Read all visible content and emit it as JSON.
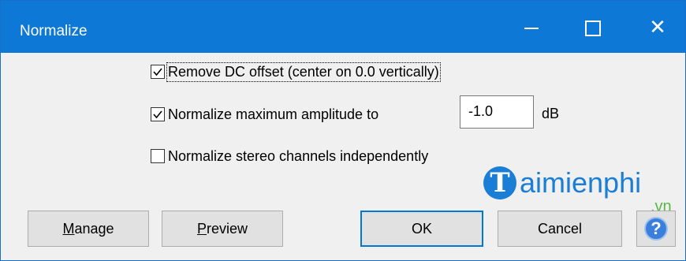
{
  "window": {
    "title": "Normalize"
  },
  "titlebar_buttons": {
    "minimize": "minimize-icon",
    "maximize": "maximize-icon",
    "close": "close-icon",
    "close_glyph": "✕"
  },
  "options": [
    {
      "label": "Remove DC offset (center on 0.0 vertically)",
      "checked": true
    },
    {
      "label": "Normalize maximum amplitude to",
      "checked": true
    },
    {
      "label": "Normalize stereo channels independently",
      "checked": false
    }
  ],
  "amplitude": {
    "value": "-1.0",
    "unit": "dB"
  },
  "watermark": {
    "initial": "T",
    "text": "aimienphi",
    "suffix": ".vn"
  },
  "buttons": {
    "manage_first": "M",
    "manage_rest": "anage",
    "preview_first": "P",
    "preview_rest": "review",
    "ok": "OK",
    "cancel": "Cancel",
    "help": "?"
  },
  "colors": {
    "titlebar": "#0e78d7",
    "accent": "#0078d7",
    "watermark_blue": "#1a7ed6",
    "watermark_green": "#58b846"
  }
}
